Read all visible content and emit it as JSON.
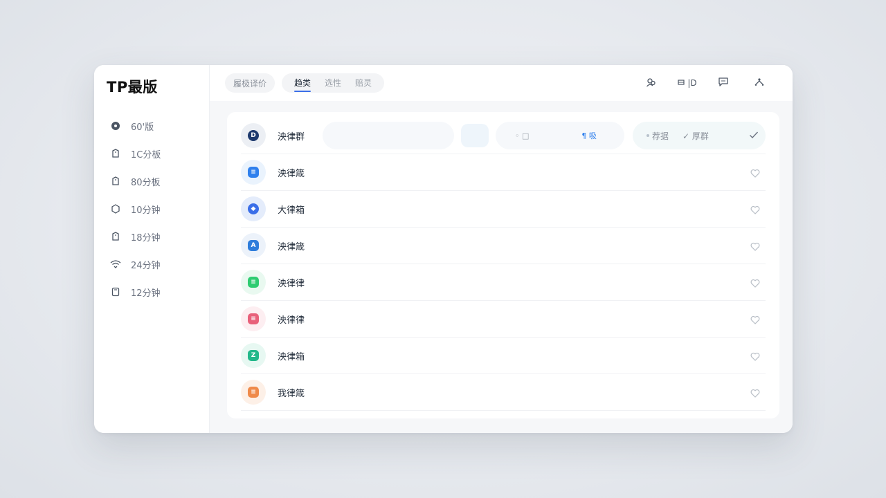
{
  "app": {
    "brand": "TP最版"
  },
  "sidebar": {
    "items": [
      {
        "label": "60'版",
        "icon": "record-icon"
      },
      {
        "label": "1C分板",
        "icon": "tag-icon"
      },
      {
        "label": "80分板",
        "icon": "tag-icon"
      },
      {
        "label": "10分钟",
        "icon": "hexagon-icon"
      },
      {
        "label": "18分钟",
        "icon": "tag-icon"
      },
      {
        "label": "24分钟",
        "icon": "wifi-icon"
      },
      {
        "label": "12分钟",
        "icon": "document-icon"
      }
    ]
  },
  "topbar": {
    "pill_label": "履极译价",
    "tabs": [
      {
        "label": "趋类",
        "active": true
      },
      {
        "label": "选性",
        "active": false
      },
      {
        "label": "赔灵",
        "active": false
      }
    ],
    "actions": [
      {
        "icon": "users-icon"
      },
      {
        "icon": "layout-icon",
        "label": "|D"
      },
      {
        "icon": "chat-icon"
      },
      {
        "icon": "share-icon"
      }
    ]
  },
  "list": {
    "rows": [
      {
        "title": "泱律群",
        "color": "#1e3a6e",
        "bg": "#eceff4",
        "icon": "logo-d-icon",
        "glyph": "D"
      },
      {
        "title": "泱律箴",
        "color": "#2f80ed",
        "bg": "#eaf3fd",
        "icon": "calendar-icon",
        "glyph": "≡"
      },
      {
        "title": "大律箱",
        "color": "#3a6ee8",
        "bg": "#e4ecfb",
        "icon": "drop-icon",
        "glyph": "◆"
      },
      {
        "title": "泱律箴",
        "color": "#2e7ddb",
        "bg": "#ecf2fa",
        "icon": "ai-icon",
        "glyph": "A"
      },
      {
        "title": "泱律律",
        "color": "#2ecc71",
        "bg": "#e9f9f0",
        "icon": "message-icon",
        "glyph": "≡"
      },
      {
        "title": "泱律律",
        "color": "#e8607a",
        "bg": "#fdeef1",
        "icon": "book-icon",
        "glyph": "≡"
      },
      {
        "title": "泱律箱",
        "color": "#22b88a",
        "bg": "#e7f8f2",
        "icon": "image-icon",
        "glyph": "Z"
      },
      {
        "title": "我律箴",
        "color": "#ef8a4a",
        "bg": "#fdf0e7",
        "icon": "box-icon",
        "glyph": "≡"
      }
    ]
  },
  "filters": {
    "search_placeholder": "",
    "group_a": "◦ □",
    "group_b": "¶ 吸",
    "chip_one": "荐据",
    "chip_two": "✓ 厚群"
  },
  "colors": {
    "accent": "#3b6ee8"
  }
}
